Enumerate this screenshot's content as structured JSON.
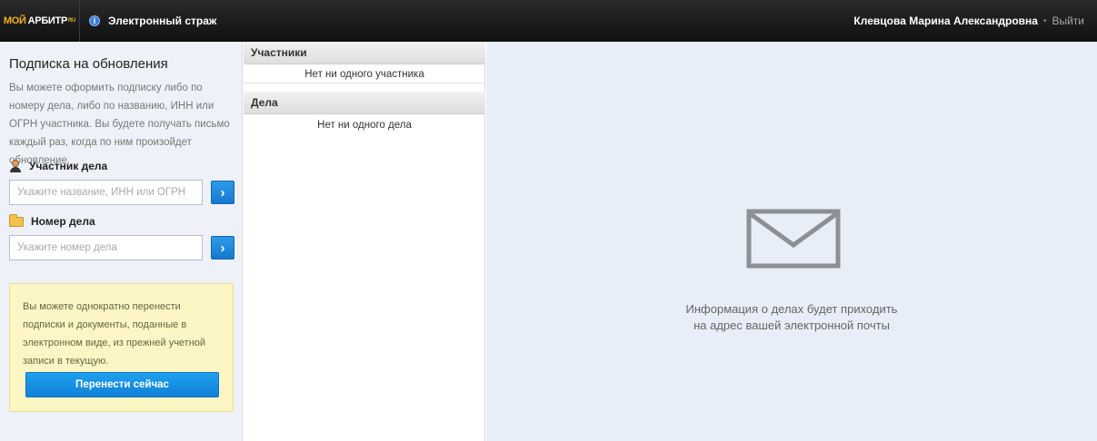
{
  "topbar": {
    "logo_part1": "МОЙ",
    "logo_part2": "АРБИТР",
    "logo_suffix": "RU",
    "guard_label": "Электронный страж",
    "user_name": "Клевцова Марина Александровна",
    "separator": "•",
    "logout_label": "Выйти"
  },
  "left": {
    "title": "Подписка на обновления",
    "description": "Вы можете оформить подписку либо по номеру дела, либо по названию, ИНН или ОГРН участника. Вы будете получать письмо каждый раз, когда по ним произойдет обновление.",
    "participant": {
      "label": "Участник дела",
      "placeholder": "Укажите название, ИНН или ОГРН",
      "value": ""
    },
    "case": {
      "label": "Номер дела",
      "placeholder": "Укажите номер дела",
      "value": ""
    },
    "go_glyph": "›",
    "notice": {
      "text": "Вы можете однократно перенести подписки и документы, поданные в электронном виде, из прежней учетной записи в текущую.",
      "button_label": "Перенести сейчас"
    }
  },
  "middle": {
    "participants_header": "Участники",
    "participants_empty": "Нет ни одного участника",
    "cases_header": "Дела",
    "cases_empty": "Нет ни одного дела"
  },
  "right": {
    "icon": "envelope-icon",
    "info_line1": "Информация о делах будет приходить",
    "info_line2": "на адрес вашей электронной почты"
  },
  "colors": {
    "topbar": "#1a1a1a",
    "accent_blue": "#1a86dc",
    "logo_gold": "#f2b21a",
    "notice_bg": "#fbf6c4",
    "right_bg": "#e8eef7"
  }
}
